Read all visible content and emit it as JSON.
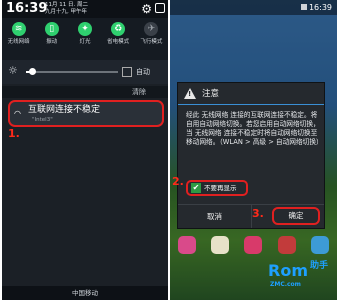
{
  "left": {
    "status": {
      "time": "16:39",
      "date_line1": "11月 11 日. 周二",
      "date_line2": "九月十九, 甲午年"
    },
    "toggles": [
      {
        "label": "无线网络",
        "icon": "wifi-icon",
        "glyph": "≋",
        "on": true
      },
      {
        "label": "振动",
        "icon": "vibrate-icon",
        "glyph": "▯",
        "on": true
      },
      {
        "label": "灯光",
        "icon": "flashlight-icon",
        "glyph": "✦",
        "on": true
      },
      {
        "label": "省电模式",
        "icon": "power-saving-icon",
        "glyph": "♻",
        "on": true
      },
      {
        "label": "飞行模式",
        "icon": "airplane-icon",
        "glyph": "✈",
        "on": false
      }
    ],
    "brightness": {
      "level": 0.08,
      "auto_label": "自动"
    },
    "notifications": {
      "clear_label": "清除"
    },
    "notification": {
      "title": "互联网连接不稳定",
      "subtitle": "\"Intel3\""
    },
    "step1": "1.",
    "carrier": "中国移动"
  },
  "right": {
    "status": {
      "time": "16:39"
    },
    "dialog": {
      "title": "注意",
      "message": "经此 无线网络 连接的互联网连接不稳定。将自用自动网络切换。若您启用自动网络切换，当 无线网络 连接不稳定时将自动网络切换至移动网络。（WLAN > 高级 > 自动网络切换）",
      "checkbox_label": "不要再显示",
      "checkbox_checked": true,
      "cancel_label": "取消",
      "ok_label": "确定"
    },
    "step2": "2.",
    "step3": "3.",
    "watermark": {
      "brand": "Rom",
      "brand_cn": "助手",
      "url": "ZMC.com"
    }
  },
  "colors": {
    "highlight": "#e02020",
    "accent_blue": "#3a8fd5",
    "toggle_on": "#2fd06f"
  }
}
